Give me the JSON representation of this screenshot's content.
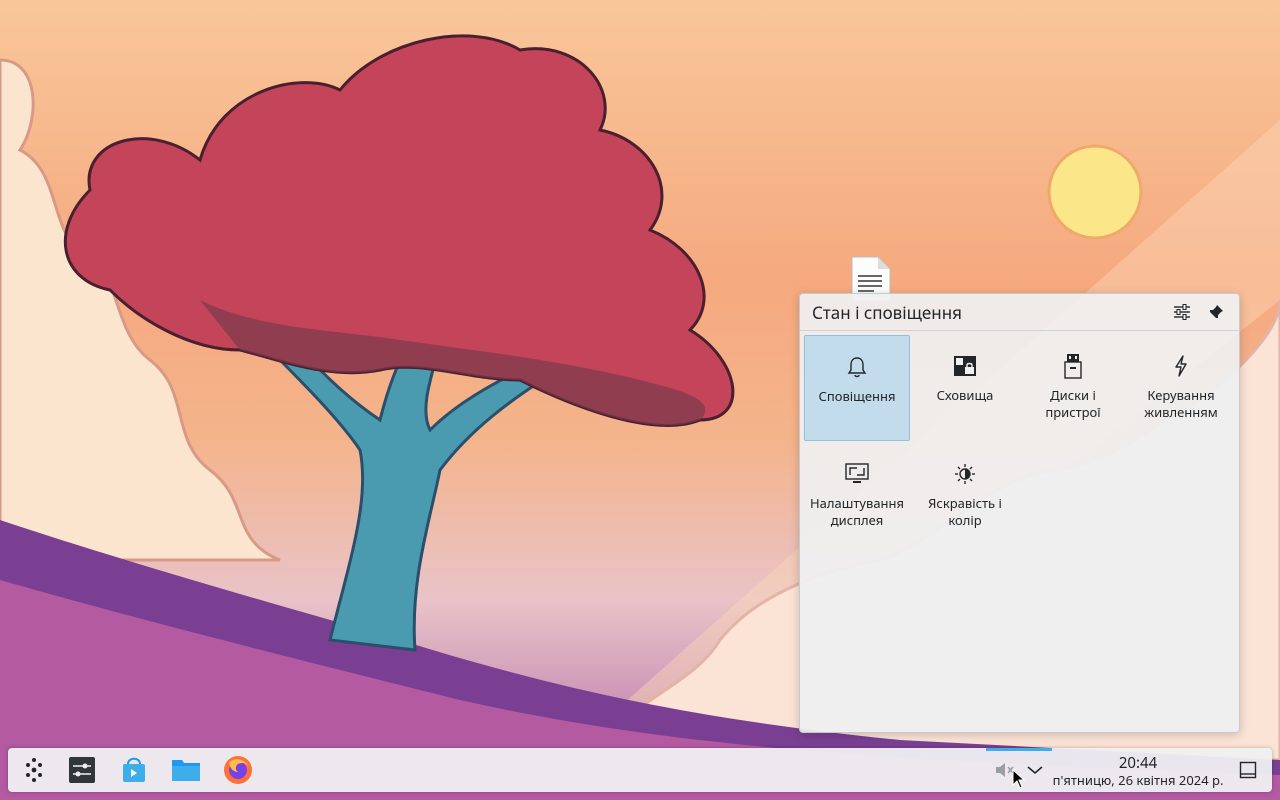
{
  "popup": {
    "title": "Стан і сповіщення",
    "tiles": [
      {
        "label": "Сповіщення",
        "icon": "bell-icon",
        "active": true
      },
      {
        "label": "Сховища",
        "icon": "vault-icon"
      },
      {
        "label": "Диски і пристрої",
        "icon": "usb-drive-icon"
      },
      {
        "label": "Керування живленням",
        "icon": "lightning-icon"
      },
      {
        "label": "Налаштування дисплея",
        "icon": "display-icon"
      },
      {
        "label": "Яскравість і колір",
        "icon": "brightness-icon"
      }
    ],
    "config_icon": "sliders-icon",
    "pin_icon": "pin-icon"
  },
  "taskbar": {
    "clock_time": "20:44",
    "clock_date": "п'ятницю, 26 квітня 2024 р.",
    "accent_color": "#3daee9"
  }
}
